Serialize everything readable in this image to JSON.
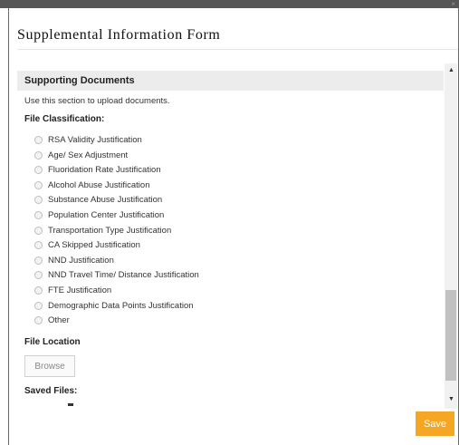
{
  "dialog": {
    "title": "Supplemental Information Form",
    "close_glyph": "×"
  },
  "section": {
    "header": "Supporting Documents",
    "description": "Use this section to upload documents.",
    "classification_label": "File Classification:",
    "options": [
      "RSA Validity Justification",
      "Age/ Sex Adjustment",
      "Fluoridation Rate Justification",
      "Alcohol Abuse Justification",
      "Substance Abuse Justification",
      "Population Center Justification",
      "Transportation Type Justification",
      "CA Skipped Justification",
      "NND Justification",
      "NND Travel Time/ Distance Justification",
      "FTE Justification",
      "Demographic Data Points Justification",
      "Other"
    ],
    "file_location_label": "File Location",
    "browse_label": "Browse",
    "saved_files_label": "Saved Files:"
  },
  "scrollbar": {
    "up_glyph": "▲",
    "down_glyph": "▼"
  },
  "footer": {
    "save_label": "Save"
  },
  "colors": {
    "save_button": "#f5a623",
    "title_bar": "#575757",
    "section_header_bg": "#ececec"
  }
}
